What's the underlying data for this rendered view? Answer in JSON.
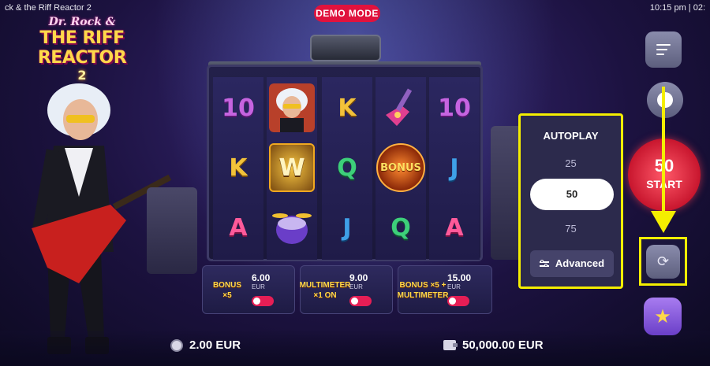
{
  "window": {
    "title": "ck & the Riff Reactor 2",
    "clock": "10:15 pm | 02:"
  },
  "badge": {
    "demo_mode": "DEMO MODE"
  },
  "logo": {
    "line1": "Dr. Rock &",
    "line2": "THE RIFF REACTOR",
    "line3": "2"
  },
  "reels": [
    [
      "10",
      "rocker",
      "A"
    ],
    [
      "",
      "W",
      "drums"
    ],
    [
      "K",
      "Q",
      "J"
    ],
    [
      "guitar",
      "BONUS",
      "Q"
    ],
    [
      "10",
      "J",
      "A"
    ]
  ],
  "features": [
    {
      "art": "BONUS ×5",
      "price": "6.00",
      "currency": "EUR",
      "enabled": true
    },
    {
      "art": "MULTIMETER ×1 ON",
      "price": "9.00",
      "currency": "EUR",
      "enabled": true
    },
    {
      "art": "BONUS ×5 + MULTIMETER",
      "price": "15.00",
      "currency": "EUR",
      "enabled": true
    }
  ],
  "bet": {
    "value": "2.00 EUR"
  },
  "balance": {
    "value": "50,000.00 EUR"
  },
  "autoplay": {
    "title": "AUTOPLAY",
    "options": [
      "25",
      "50",
      "75"
    ],
    "selected": "50",
    "advanced_label": "Advanced"
  },
  "start": {
    "count": "50",
    "label": "START"
  },
  "icons": [
    "menu-icon",
    "sound-toggle-icon",
    "autoplay-icon",
    "star-icon",
    "coin-icon",
    "wallet-icon"
  ],
  "colors": {
    "highlight": "#f4ee00",
    "demo": "#e0123d",
    "start": "#d91a34",
    "toggle_on": "#e61e55"
  }
}
